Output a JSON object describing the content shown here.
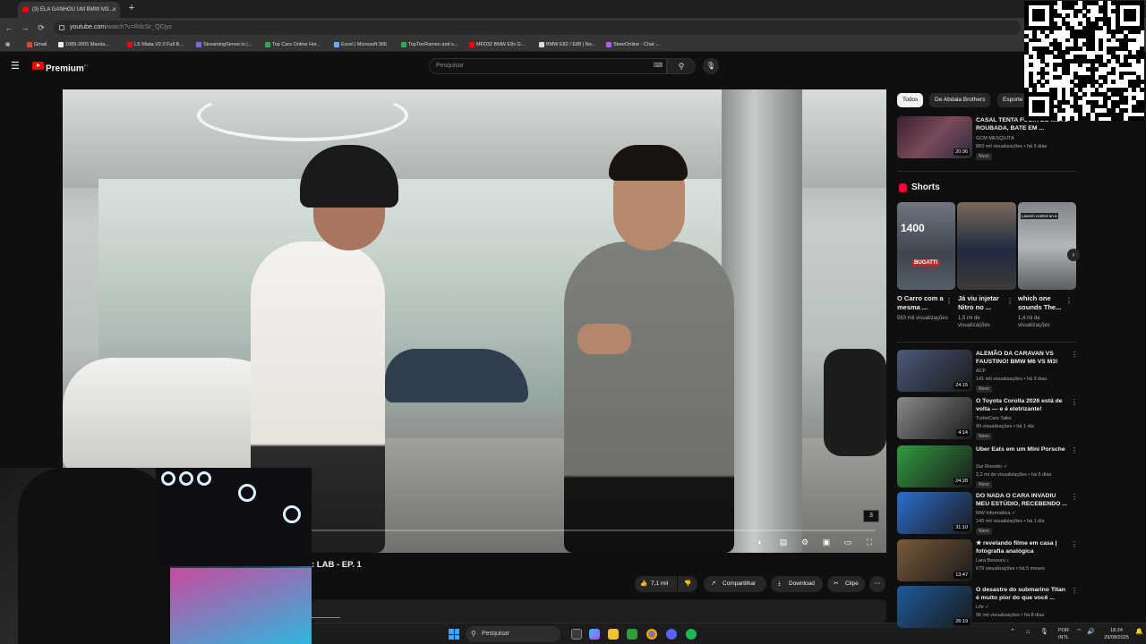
{
  "browser": {
    "tab_title": "(3) ELA GANHOU UM BMW M3...",
    "tab_close": "×",
    "new_tab": "+",
    "back": "←",
    "forward": "→",
    "reload": "⟳",
    "url_host": "youtube.com",
    "url_path": "/watch?v=RdcSr_QCjyc",
    "bookmarks": [
      {
        "label": "Gmail",
        "color": "#ea4335"
      },
      {
        "label": "1989-2005 Mazda...",
        "color": "#eeeeee"
      },
      {
        "label": "LS Miata V2.0 Full B...",
        "color": "#ff0000"
      },
      {
        "label": "StreamingServer.io |...",
        "color": "#7b68ee"
      },
      {
        "label": "Top Cars Online Hor...",
        "color": "#34a853"
      },
      {
        "label": "Excel | Microsoft 365",
        "color": "#6aa9ff"
      },
      {
        "label": "TopTierRamen and s...",
        "color": "#34a853"
      },
      {
        "label": "MFD32 BMW E8x G...",
        "color": "#ff0000"
      },
      {
        "label": "BMW E82 / E88 | No...",
        "color": "#dddddd"
      },
      {
        "label": "SteerOnline - Chat -...",
        "color": "#b15cff"
      }
    ]
  },
  "youtube": {
    "logo_text": "Premium",
    "logo_region": "PT",
    "search_placeholder": "Pesquisar",
    "video_title": ": LAB - EP. 1",
    "watermark": "3",
    "progress_fraction": 0.0,
    "actions": {
      "like_count": "7,1 mil",
      "share": "Compartilhar",
      "download": "Download",
      "clip": "Clipe",
      "more": "⋯"
    }
  },
  "sidebar": {
    "chips": [
      "Todos",
      "De Abdala Brothers",
      "Esporte"
    ],
    "top_video": {
      "title": "CASAL TENTA FUGIR DE MOTO ROUBADA, BATE EM ...",
      "channel": "GCM MESQUITA",
      "meta": "883 mil visualizações • há 5 dias",
      "badge": "Novo",
      "duration": "20:36"
    },
    "shorts_heading": "Shorts",
    "shorts": [
      {
        "title": "O Carro com a mesma ...",
        "views": "563 mil visualizações",
        "overlay": "1400",
        "tag": "BUGATTI"
      },
      {
        "title": "Já viu injetar Nitro no ...",
        "views": "1,5 mi de visualizações",
        "overlay": "",
        "tag": ""
      },
      {
        "title": "which one sounds The...",
        "views": "1,4 mi de visualizações",
        "overlay": "Launch control on a",
        "tag": ""
      }
    ],
    "videos": [
      {
        "title": "ALEMÃO DA CARAVAN VS FAUSTINO! BMW M6 VS M3!",
        "channel": "ACF",
        "meta": "141 mil visualizações • há 3 dias",
        "badge": "Novo",
        "duration": "24:15",
        "color": "#4a5a7a"
      },
      {
        "title": "O Toyota Corolla 2026 está de volta — e é eletrizante!",
        "channel": "TurboCars Talks",
        "meta": "99 visualizações • há 1 dia",
        "badge": "Novo",
        "duration": "4:14",
        "color": "#8a8a8a"
      },
      {
        "title": "Uber Eats em um Mini Porsche",
        "channel": "Sur Rooster ✓",
        "meta": "2,2 mi de visualizações • há 6 dias",
        "badge": "Novo",
        "duration": "24:28",
        "color": "#2f9c3f"
      },
      {
        "title": "DO NADA O CARA INVADIU MEU ESTÚDIO, RECEBENDO ...",
        "channel": "MW Informática ✓",
        "meta": "140 mil visualizações • há 1 dia",
        "badge": "Novo",
        "duration": "31:10",
        "color": "#2c6fd1"
      },
      {
        "title": "★ revelando filme em casa | fotografia analógica",
        "channel": "Lara Besouro ♪",
        "meta": "679 visualizações • há 5 meses",
        "badge": "",
        "duration": "13:47",
        "color": "#7a5a3a"
      },
      {
        "title": "O desastre do submarino Titan é muito pior do que você ...",
        "channel": "Life ✓",
        "meta": "96 mil visualizações • há 8 dias",
        "badge": "",
        "duration": "26:19",
        "color": "#1d5a9a"
      }
    ]
  },
  "taskbar": {
    "search_placeholder": "Pesquisar",
    "lang_top": "POR",
    "lang_bottom": "INTL",
    "time": "18:24",
    "date": "29/08/2025"
  }
}
